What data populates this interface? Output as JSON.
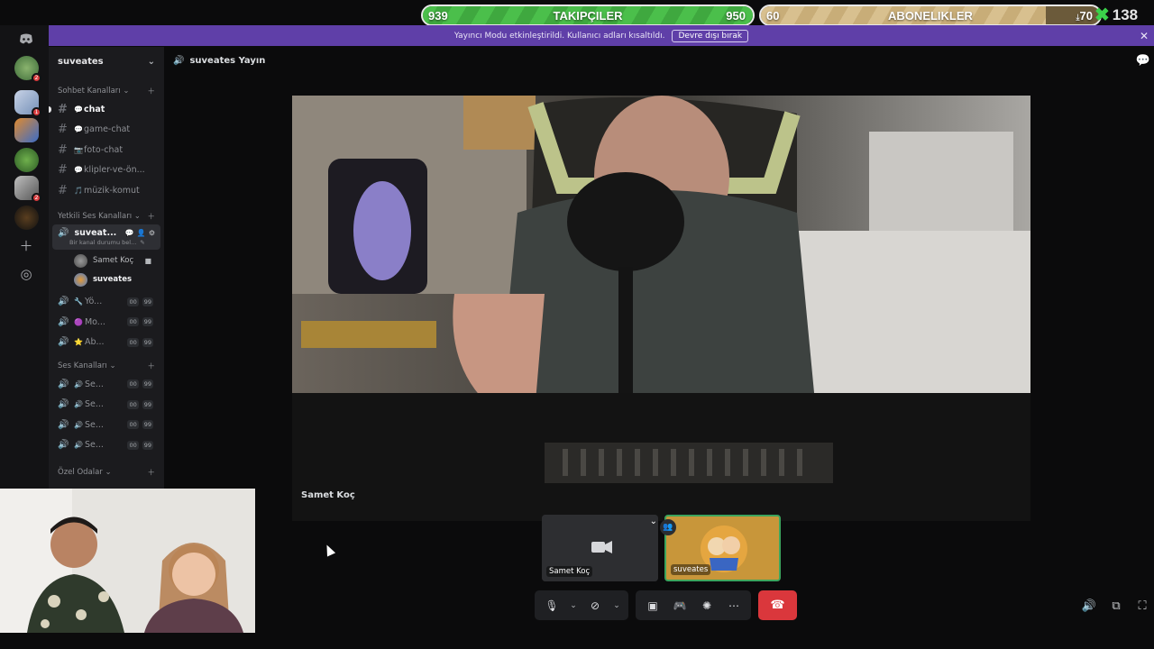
{
  "overlay": {
    "followers": {
      "start": "939",
      "label": "TAKIPÇILER",
      "end": "950",
      "progress": 0.0
    },
    "subscriptions": {
      "start": "60",
      "label": "ABONELIKLER",
      "end": "70",
      "progress": 0.0
    },
    "counter": "138"
  },
  "notice": {
    "text": "Yayıncı Modu etkinleştirildi. Kullanıcı adları kısaltıldı.",
    "button": "Devre dışı bırak"
  },
  "server": {
    "name": "suveates"
  },
  "categories": {
    "text": "Sohbet Kanalları",
    "authorized_voice": "Yetkili Ses Kanalları",
    "voice": "Ses Kanalları",
    "private": "Özel Odalar"
  },
  "text_channels": [
    {
      "name": "chat",
      "emoji": "💬"
    },
    {
      "name": "game-chat",
      "emoji": "💬"
    },
    {
      "name": "foto-chat",
      "emoji": "📷"
    },
    {
      "name": "klipler-ve-ön...",
      "emoji": "💬"
    },
    {
      "name": "müzik-komut",
      "emoji": "🎵"
    }
  ],
  "active_voice": {
    "name": "suveat...",
    "status": "Bir kanal durumu bel..."
  },
  "voice_users": [
    {
      "name": "Samet Koç"
    },
    {
      "name": "suveates"
    }
  ],
  "authorized_channels": [
    {
      "name": "Yö...",
      "emoji": "🔧",
      "count": "00",
      "limit": "99"
    },
    {
      "name": "Mo...",
      "emoji": "🟣",
      "count": "00",
      "limit": "99"
    },
    {
      "name": "Ab...",
      "emoji": "⭐",
      "count": "00",
      "limit": "99"
    }
  ],
  "voice_channels": [
    {
      "name": "Se...",
      "emoji": "🔊",
      "count": "00",
      "limit": "99"
    },
    {
      "name": "Se...",
      "emoji": "🔊",
      "count": "00",
      "limit": "99"
    },
    {
      "name": "Se...",
      "emoji": "🔊",
      "count": "00",
      "limit": "99"
    },
    {
      "name": "Se...",
      "emoji": "🔊",
      "count": "00",
      "limit": "99"
    }
  ],
  "main": {
    "stream_title": "suveates Yayın",
    "video_name": "Samet Koç",
    "tiles": [
      {
        "name": "Samet Koç"
      },
      {
        "name": "suveates"
      }
    ]
  },
  "colors": {
    "notice": "#5f3fa8",
    "hangup": "#da373c",
    "followers_bar": "#4bbf4b",
    "subs_bar": "#d8c08f"
  }
}
